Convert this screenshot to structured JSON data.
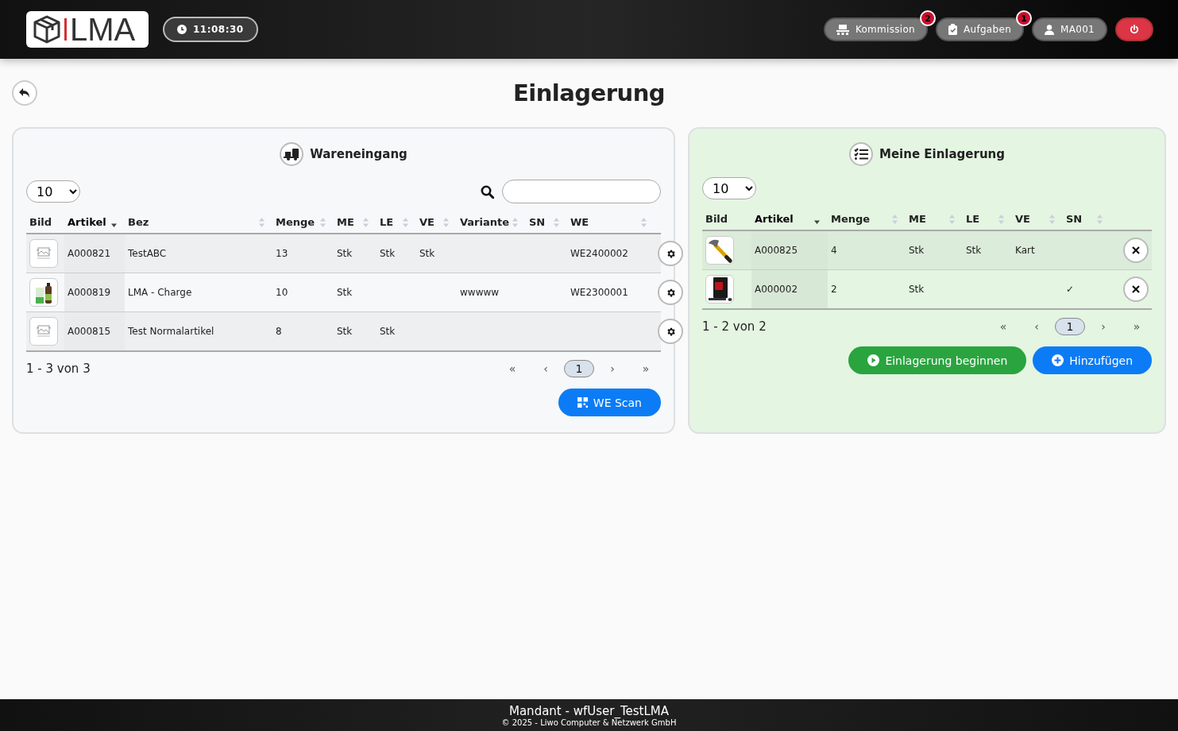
{
  "header": {
    "logo": "LMA",
    "clock": "11:08:30",
    "buttons": [
      {
        "kind": "pallet",
        "label": "Kommission",
        "badge": "2"
      },
      {
        "kind": "clipboard",
        "label": "Aufgaben",
        "badge": "1"
      },
      {
        "kind": "user",
        "label": "MA001"
      },
      {
        "kind": "power"
      }
    ]
  },
  "page": {
    "title": "Einlagerung"
  },
  "panels": [
    {
      "kind": "incoming",
      "title": "Wareneingang",
      "page_size": "10",
      "columns": [
        {
          "label": "Bild",
          "sorted": false
        },
        {
          "label": "Artikel",
          "sorted": true
        },
        {
          "label": "Bez",
          "sorted": false
        },
        {
          "label": "Menge",
          "sorted": false
        },
        {
          "label": "ME",
          "sorted": false
        },
        {
          "label": "LE",
          "sorted": false
        },
        {
          "label": "VE",
          "sorted": false
        },
        {
          "label": "Variante",
          "sorted": false
        },
        {
          "label": "SN",
          "sorted": false
        },
        {
          "label": "WE",
          "sorted": false
        }
      ],
      "rows": [
        {
          "cells": [
            "",
            "A000821",
            "TestABC",
            "13",
            "Stk",
            "Stk",
            "Stk",
            "",
            "",
            "WE2400002"
          ]
        },
        {
          "cells": [
            "",
            "A000819",
            "LMA - Charge",
            "10",
            "Stk",
            "",
            "",
            "wwwww",
            "",
            "WE2300001"
          ]
        },
        {
          "cells": [
            "",
            "A000815",
            "Test Normalartikel",
            "8",
            "Stk",
            "Stk",
            "",
            "",
            "",
            ""
          ]
        }
      ],
      "summary": "1 - 3 von 3",
      "pager": [
        {
          "label": "«",
          "selected": false
        },
        {
          "label": "‹",
          "selected": false
        },
        {
          "label": "1",
          "selected": true
        },
        {
          "label": "›",
          "selected": false
        },
        {
          "label": "»",
          "selected": false
        }
      ],
      "actions": [
        {
          "kind": "scan",
          "label": "WE Scan"
        }
      ]
    },
    {
      "kind": "mine",
      "title": "Meine Einlagerung",
      "page_size": "10",
      "columns": [
        {
          "label": "Bild",
          "sorted": false
        },
        {
          "label": "Artikel",
          "sorted": true
        },
        {
          "label": "Menge",
          "sorted": false
        },
        {
          "label": "ME",
          "sorted": false
        },
        {
          "label": "LE",
          "sorted": false
        },
        {
          "label": "VE",
          "sorted": false
        },
        {
          "label": "SN",
          "sorted": false
        }
      ],
      "rows": [
        {
          "cells": [
            "",
            "A000825",
            "4",
            "Stk",
            "Stk",
            "Kart",
            ""
          ]
        },
        {
          "cells": [
            "",
            "A000002",
            "2",
            "Stk",
            "",
            "",
            "✓"
          ]
        }
      ],
      "summary": "1 - 2 von 2",
      "pager": [
        {
          "label": "«",
          "selected": false
        },
        {
          "label": "‹",
          "selected": false
        },
        {
          "label": "1",
          "selected": true
        },
        {
          "label": "›",
          "selected": false
        },
        {
          "label": "»",
          "selected": false
        }
      ],
      "actions": [
        {
          "kind": "start",
          "label": "Einlagerung beginnen"
        },
        {
          "kind": "add",
          "label": "Hinzufügen"
        }
      ]
    }
  ],
  "footer": {
    "tenant": "Mandant - wfUser_TestLMA",
    "copyright": "© 2025 - Liwo Computer & Netzwerk GmbH"
  }
}
